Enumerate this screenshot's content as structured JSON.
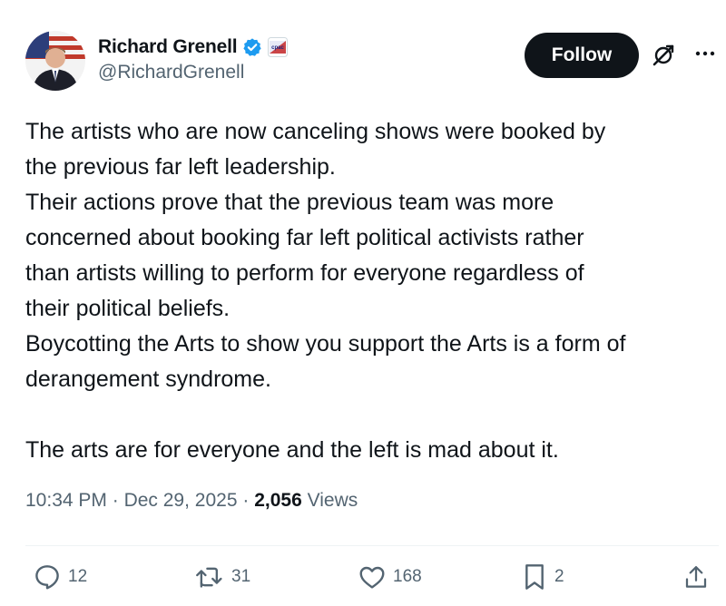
{
  "author": {
    "display_name": "Richard Grenell",
    "handle": "@RichardGrenell",
    "affiliate_badge_text": "cpac"
  },
  "follow_label": "Follow",
  "tweet": {
    "lines": [
      "The artists who are now canceling shows were booked by",
      "the previous far left leadership.",
      "Their actions prove that the previous team was more",
      "concerned about booking far left political activists rather",
      "than artists willing to perform for everyone regardless of",
      "their political beliefs.",
      "Boycotting the Arts to show you support the Arts is a form of",
      "derangement syndrome."
    ],
    "closing_line": "The arts are for everyone and the left is mad about it."
  },
  "meta": {
    "time": "10:34 PM",
    "date": "Dec 29, 2025",
    "separator": "·",
    "views_count": "2,056",
    "views_label": "Views"
  },
  "actions": {
    "replies": "12",
    "reposts": "31",
    "likes": "168",
    "bookmarks": "2"
  },
  "colors": {
    "text": "#0f1419",
    "secondary": "#536471",
    "verified": "#1d9bf0",
    "follow_bg": "#0f1419"
  }
}
